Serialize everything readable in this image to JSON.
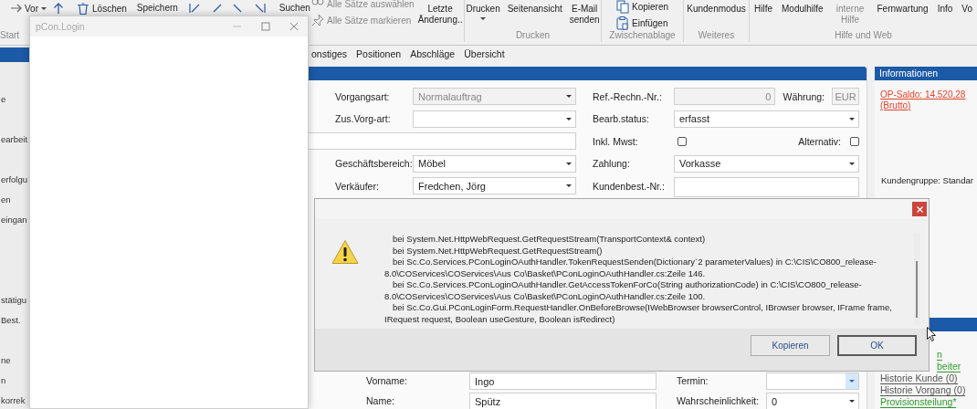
{
  "ribbon": {
    "start_label": "Start",
    "history": {
      "label": "Vor"
    },
    "record_buttons": [
      {
        "label": "Löschen"
      },
      {
        "label": "Speichern"
      }
    ],
    "search_label": "Suchen",
    "selection": [
      {
        "label": "Alle Sätze auswählen",
        "disabled": true
      },
      {
        "label": "Alle Sätze markieren",
        "disabled": true
      }
    ],
    "last_change": "Letzte Änderung..",
    "groups": [
      {
        "label": "Drucken",
        "items": [
          {
            "kind": "large",
            "label": "Drucken",
            "dropdown": true
          },
          {
            "kind": "large",
            "label": "Seitenansicht"
          },
          {
            "kind": "large",
            "label": "E-Mail senden"
          }
        ]
      },
      {
        "label": "Zwischenablage",
        "items": [
          {
            "kind": "small",
            "label": "Kopieren"
          },
          {
            "kind": "small",
            "label": "Einfügen"
          }
        ]
      },
      {
        "label": "Weiteres",
        "items": [
          {
            "kind": "large",
            "label": "Kundenmodus"
          }
        ]
      },
      {
        "label": "Hilfe und Web",
        "items": [
          {
            "kind": "large",
            "label": "Hilfe"
          },
          {
            "kind": "large",
            "label": "Modulhilfe"
          },
          {
            "kind": "large",
            "label": "interne Hilfe",
            "disabled": true
          },
          {
            "kind": "large",
            "label": "Fernwartung"
          },
          {
            "kind": "large",
            "label": "Info"
          },
          {
            "kind": "large",
            "label": "Vo"
          }
        ]
      }
    ]
  },
  "sidebar": {
    "items": [
      {
        "label": "e"
      },
      {
        "label": "earbeit"
      },
      {
        "label": "erfolgu"
      },
      {
        "label": "en"
      },
      {
        "label": "eingan"
      },
      {
        "label": "stätigu"
      },
      {
        "label": "Best."
      },
      {
        "label": "ne"
      },
      {
        "label": "n"
      },
      {
        "label": "korrek"
      }
    ]
  },
  "tabs": [
    {
      "label": "onstiges",
      "selected": false
    },
    {
      "label": "Positionen",
      "selected": false
    },
    {
      "label": "Abschläge",
      "selected": false
    },
    {
      "label": "Übersicht",
      "selected": false
    }
  ],
  "form": {
    "left": [
      {
        "kind": "combo",
        "label": "Vorgangsart:",
        "value": "Normalauftrag",
        "disabled": true
      },
      {
        "kind": "combo",
        "label": "Zus.Vorg-art:",
        "disabled": false
      },
      {
        "kind": "wide"
      },
      {
        "kind": "combo",
        "label": "Geschäftsbereich:",
        "value": "Möbel",
        "disabled": false
      },
      {
        "kind": "combo",
        "label": "Verkäufer:",
        "value": "Fredchen, Jörg",
        "disabled": false
      }
    ],
    "right": [
      {
        "kind": "ref",
        "label": "Ref.-Rechn.-Nr.:",
        "value": "0",
        "currency_label": "Währung:",
        "currency": "EUR"
      },
      {
        "kind": "combo",
        "label": "Bearb.status:",
        "value": "erfasst",
        "disabled": false
      },
      {
        "kind": "checks",
        "label": "Inkl. Mwst:",
        "checked": false,
        "second_label": "Alternativ:",
        "second_checked": false
      },
      {
        "kind": "combo",
        "label": "Zahlung:",
        "value": "Vorkasse",
        "disabled": false
      },
      {
        "kind": "memo",
        "label": "Kundenbest.-Nr.:"
      }
    ],
    "bottom_left": [
      {
        "label": "Vorname:",
        "value": "Ingo"
      },
      {
        "label": "Name:",
        "value": "Spütz"
      }
    ],
    "bottom_right": [
      {
        "label": "Termin:",
        "focused": true
      },
      {
        "label": "Wahrscheinlichkeit:",
        "value": "0",
        "focused": false
      }
    ]
  },
  "info": {
    "title": "Informationen",
    "balance": "OP-Saldo: 14.520,28 (Brutto)",
    "customer_group": "Kundengruppe: Standar",
    "links": [
      {
        "label": "n",
        "color": "#2f9a2f"
      },
      {
        "label": "beiter",
        "color": "#2f9a2f"
      },
      {
        "label": "Historie Kunde (0)",
        "color": "#555555"
      },
      {
        "label": "Historie Vorgang (0)",
        "color": "#555555"
      },
      {
        "label": "Provisionsteilung*",
        "color": "#2f9a2f"
      }
    ]
  },
  "login_window": {
    "title": "pCon.Login"
  },
  "error_dialog": {
    "lines": [
      "bei System.Net.HttpWebRequest.GetRequestStream(TransportContext& context)",
      "bei System.Net.HttpWebRequest.GetRequestStream()",
      "bei Sc.Co.Services.PConLoginOAuthHandler.TokenRequestSenden(Dictionary`2 parameterValues) in C:\\CIS\\CO800_release-8.0\\COServices\\COServices\\Aus Co\\Basket\\PConLoginOAuthHandler.cs:Zeile 146.",
      "bei Sc.Co.Services.PConLoginOAuthHandler.GetAccessTokenForCo(String authorizationCode) in C:\\CIS\\CO800_release-8.0\\COServices\\COServices\\Aus Co\\Basket\\PConLoginOAuthHandler.cs:Zeile 100.",
      "bei Sc.Co.Gui.PConLoginForm.RequestHandler.OnBeforeBrowse(IWebBrowser browserControl, IBrowser browser, IFrame frame, IRequest request, Boolean useGesture, Boolean isRedirect)"
    ],
    "buttons": [
      {
        "label": "Kopieren",
        "default": false
      },
      {
        "label": "OK",
        "default": true
      }
    ]
  }
}
